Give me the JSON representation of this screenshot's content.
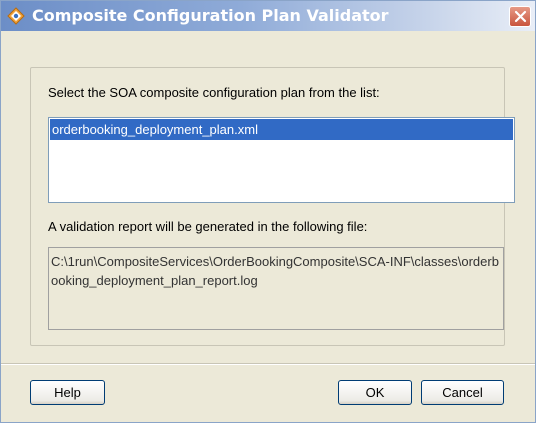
{
  "window": {
    "title": "Composite Configuration Plan Validator",
    "icon": "oracle-app-icon"
  },
  "plan_section": {
    "prompt": "Select the SOA composite configuration plan from the list:",
    "plans": [
      "orderbooking_deployment_plan.xml"
    ],
    "selected_plan": "orderbooking_deployment_plan.xml"
  },
  "report_section": {
    "label": "A validation report will be generated in the following file:",
    "file_path": "C:\\1run\\CompositeServices\\OrderBookingComposite\\SCA-INF\\classes\\orderbooking_deployment_plan_report.log"
  },
  "buttons": {
    "help": "Help",
    "ok": "OK",
    "cancel": "Cancel"
  },
  "colors": {
    "title_text": "#ffffff",
    "selection": "#316ac5",
    "dialog_bg": "#ece9d8",
    "close_button": "#c9553d"
  }
}
